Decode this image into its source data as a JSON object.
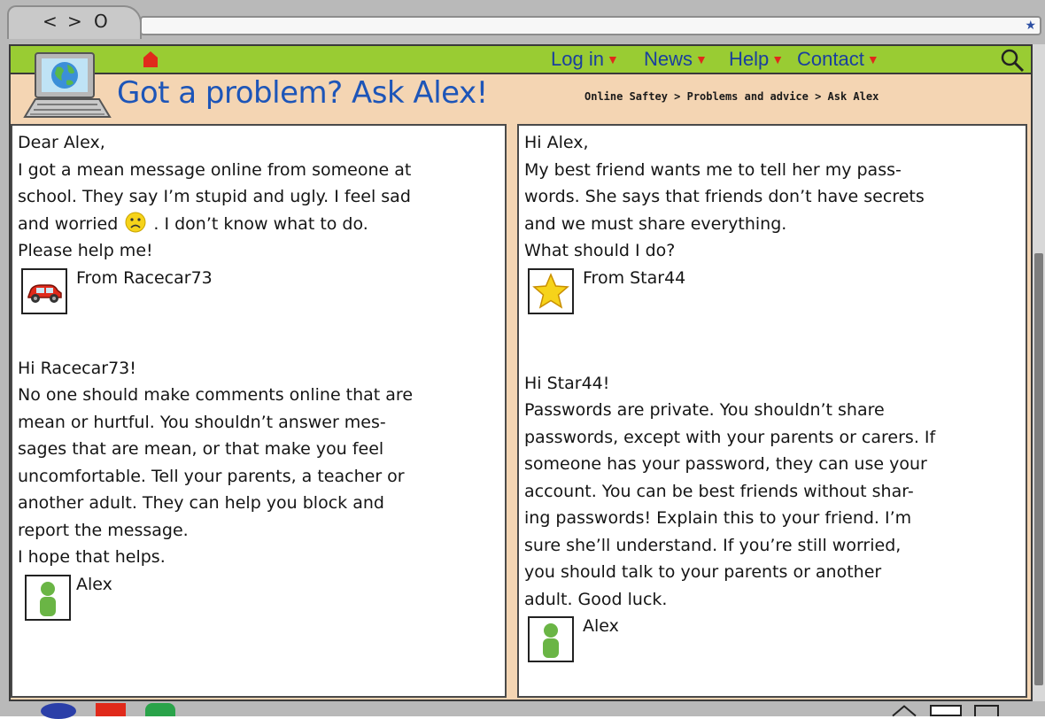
{
  "page": {
    "title": "Got a problem? Ask Alex!",
    "breadcrumb": "Online Saftey > Problems and advice > Ask Alex"
  },
  "browser": {
    "back_label": "<",
    "forward_label": ">",
    "reload_label": "O"
  },
  "menu": {
    "items": [
      {
        "label": "Log in"
      },
      {
        "label": "News"
      },
      {
        "label": "Help"
      },
      {
        "label": "Contact"
      }
    ],
    "arrow": "▼"
  },
  "colors": {
    "menubar": "#99cc33",
    "page_bg": "#f4d5b3",
    "title": "#1d55b8",
    "menu_text": "#1a3f9e",
    "menu_arrow": "#e02a1b"
  },
  "letters": [
    {
      "question": [
        "Dear Alex,",
        "I got a mean message online from someone at",
        "school. They say I’m stupid and ugly. I feel sad",
        "and worried",
        ". I don’t know what to do.",
        "Please help me!"
      ],
      "from": "From Racecar73",
      "from_icon": "car-icon",
      "reply": [
        "Hi Racecar73!",
        "No one should make comments online that are",
        "mean or hurtful. You shouldn’t answer mes-",
        "sages that are mean, or that make you feel",
        "uncomfortable. Tell your parents, a teacher or",
        "another adult. They can help you block and",
        "report the message.",
        "I hope that helps."
      ],
      "signature": "Alex",
      "signature_icon": "person-icon"
    },
    {
      "question": [
        "Hi Alex,",
        "My best friend wants me to tell her my pass-",
        "words. She says that friends don’t have secrets",
        "and we must share everything.",
        "What should I do?"
      ],
      "from": "From Star44",
      "from_icon": "star-icon",
      "reply": [
        "Hi Star44!",
        "Passwords are private. You shouldn’t share",
        "passwords, except with your parents or carers. If",
        "someone has your password, they can use your",
        "account. You can be best friends without shar-",
        "ing passwords! Explain this to your friend. I’m",
        "sure she’ll  understand. If you’re still worried,",
        "you should talk to your parents or another",
        "adult. Good luck."
      ],
      "signature": "Alex",
      "signature_icon": "person-icon"
    }
  ]
}
